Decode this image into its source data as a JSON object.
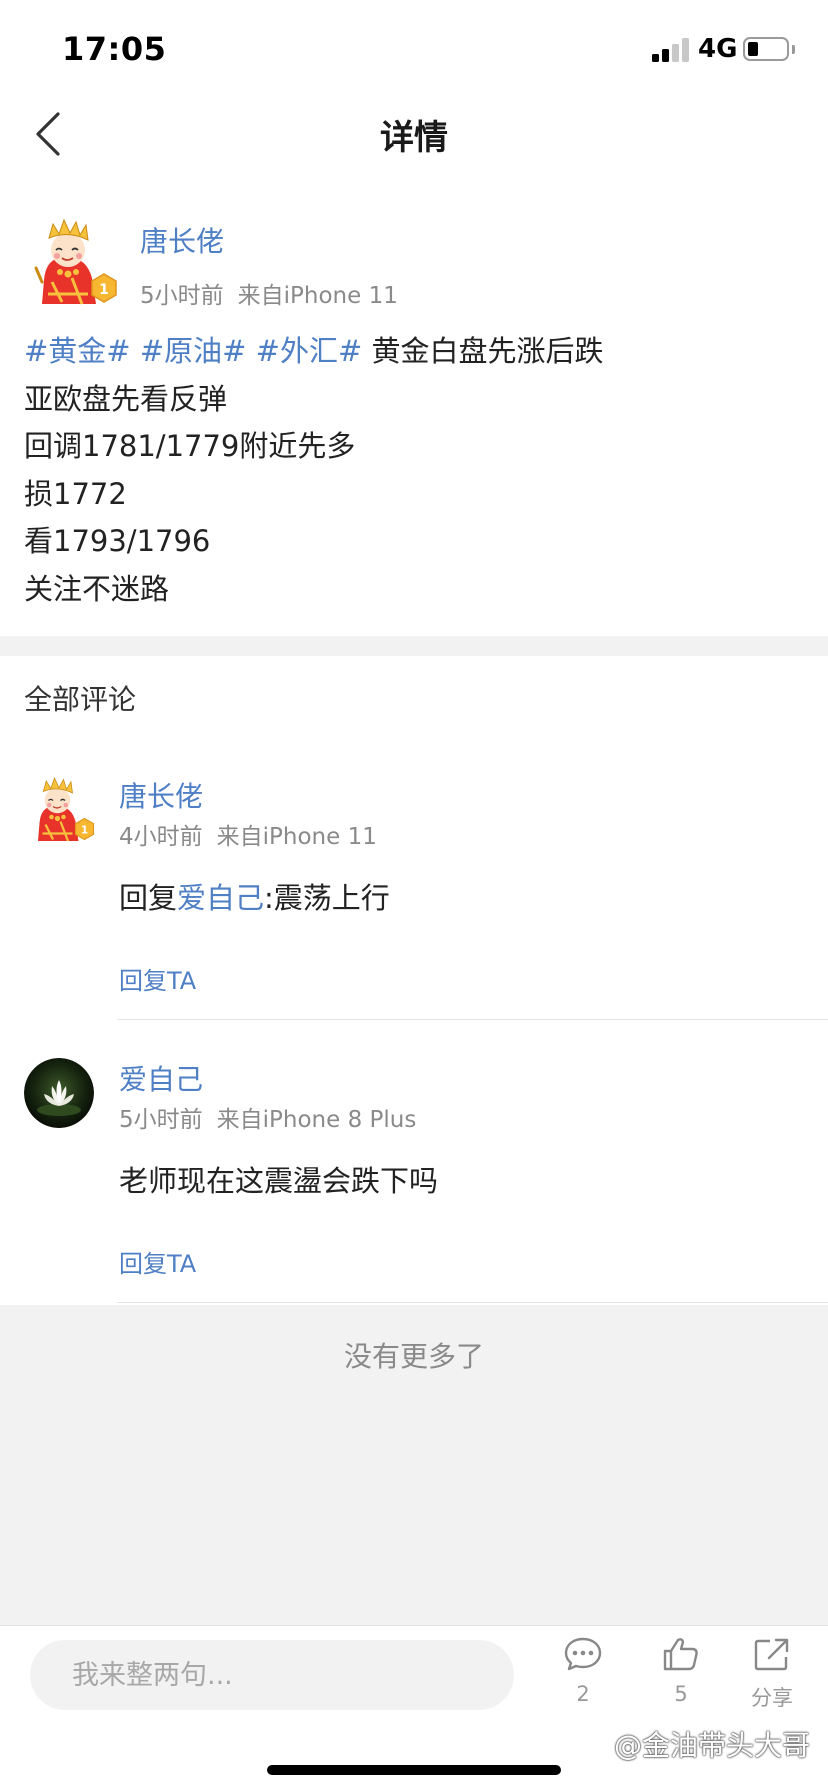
{
  "status_bar": {
    "time": "17:05",
    "network": "4G",
    "signal_bars": 2,
    "signal_bars_total": 4,
    "battery_level": 0.2
  },
  "nav": {
    "title": "详情"
  },
  "post": {
    "author": "唐长佬",
    "time": "5小时前",
    "source": "来自iPhone 11",
    "avatar_badge": "1",
    "hashtags": [
      "#黄金#",
      "#原油#",
      "#外汇#"
    ],
    "first_line_text": "黄金白盘先涨后跌",
    "lines": [
      "亚欧盘先看反弹",
      "回调1781/1779附近先多",
      "损1772",
      "看1793/1796",
      "关注不迷路"
    ]
  },
  "comments_section": {
    "title": "全部评论"
  },
  "comments": [
    {
      "author": "唐长佬",
      "time": "4小时前",
      "source": "来自iPhone 11",
      "avatar_badge": "1",
      "text_prefix": "回复",
      "mention": "爱自己",
      "text": ":震荡上行",
      "reply_label": "回复TA"
    },
    {
      "author": "爱自己",
      "time": "5小时前",
      "source": "来自iPhone 8 Plus",
      "text": "老师现在这震盪会跌下吗",
      "reply_label": "回复TA"
    }
  ],
  "footer": {
    "no_more": "没有更多了"
  },
  "bottom_bar": {
    "input_placeholder": "我来整两句...",
    "comment_count": "2",
    "like_count": "5",
    "share_label": "分享"
  },
  "watermark": "@金油带头大哥",
  "colors": {
    "link": "#4f7fc4",
    "meta": "#8a8a8a",
    "gap": "#f2f2f2"
  }
}
